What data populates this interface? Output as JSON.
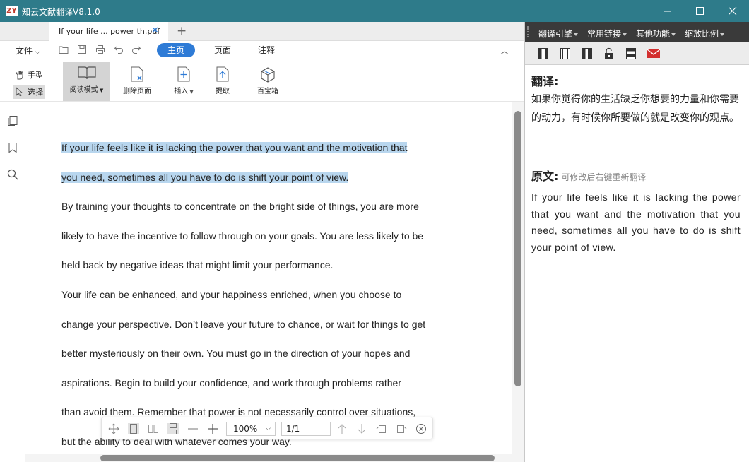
{
  "app": {
    "logo_text": "ZY",
    "title": "知云文献翻译V8.1.0"
  },
  "window_controls": {
    "minimize": "minimize",
    "maximize": "maximize",
    "close": "close"
  },
  "tabs": [
    {
      "label": "If your life ... power th.pdf"
    }
  ],
  "toolbar": {
    "file_menu": "文件",
    "ribbon_tabs": [
      {
        "label": "主页",
        "active": true
      },
      {
        "label": "页面",
        "active": false
      },
      {
        "label": "注释",
        "active": false
      }
    ],
    "hand_tool": "手型",
    "select_tool": "选择",
    "read_mode": "阅读模式",
    "delete_page": "删除页面",
    "insert": "插入",
    "extract": "提取",
    "toolbox": "百宝箱"
  },
  "document": {
    "paragraphs": [
      {
        "lines": [
          "If your life feels like it is lacking the power that you want and the motivation that",
          "you need, sometimes all you have to do is shift your point of view."
        ],
        "highlighted": true
      },
      {
        "lines": [
          "By training your thoughts to concentrate on the bright side of things, you are more",
          "likely to have the incentive to follow through on your goals. You are less likely to be",
          "held back by negative ideas that might limit your performance."
        ],
        "highlighted": false
      },
      {
        "lines": [
          "Your life can be enhanced, and your happiness enriched, when you choose to",
          "change your perspective. Don’t leave your future to chance, or wait for things to get",
          "better mysteriously on their own. You must go in the direction of your hopes and",
          "aspirations. Begin to build your confidence, and work through problems rather",
          "than avoid them. Remember that power is not necessarily control over situations,",
          "but the ability to deal with whatever comes your way."
        ],
        "highlighted": false
      }
    ],
    "highlight_color": "#b8d6ee"
  },
  "floatbar": {
    "zoom": "100%",
    "page": "1/1"
  },
  "right_panel": {
    "menus": [
      "翻译引擎",
      "常用链接",
      "其他功能",
      "缩放比例"
    ],
    "translation_heading": "翻译:",
    "translation_text": "如果你觉得你的生活缺乏你想要的力量和你需要的动力，有时候你所要做的就是改变你的观点。",
    "source_heading": "原文:",
    "source_note": "可修改后右键重新翻译",
    "source_text": "If your life feels like it is lacking the power that you want and the motivation that you need, sometimes all you have to do is shift your point of view."
  },
  "colors": {
    "titlebar": "#2e7b8a",
    "accent": "#2e7bd6",
    "mail": "#d32f2f"
  }
}
